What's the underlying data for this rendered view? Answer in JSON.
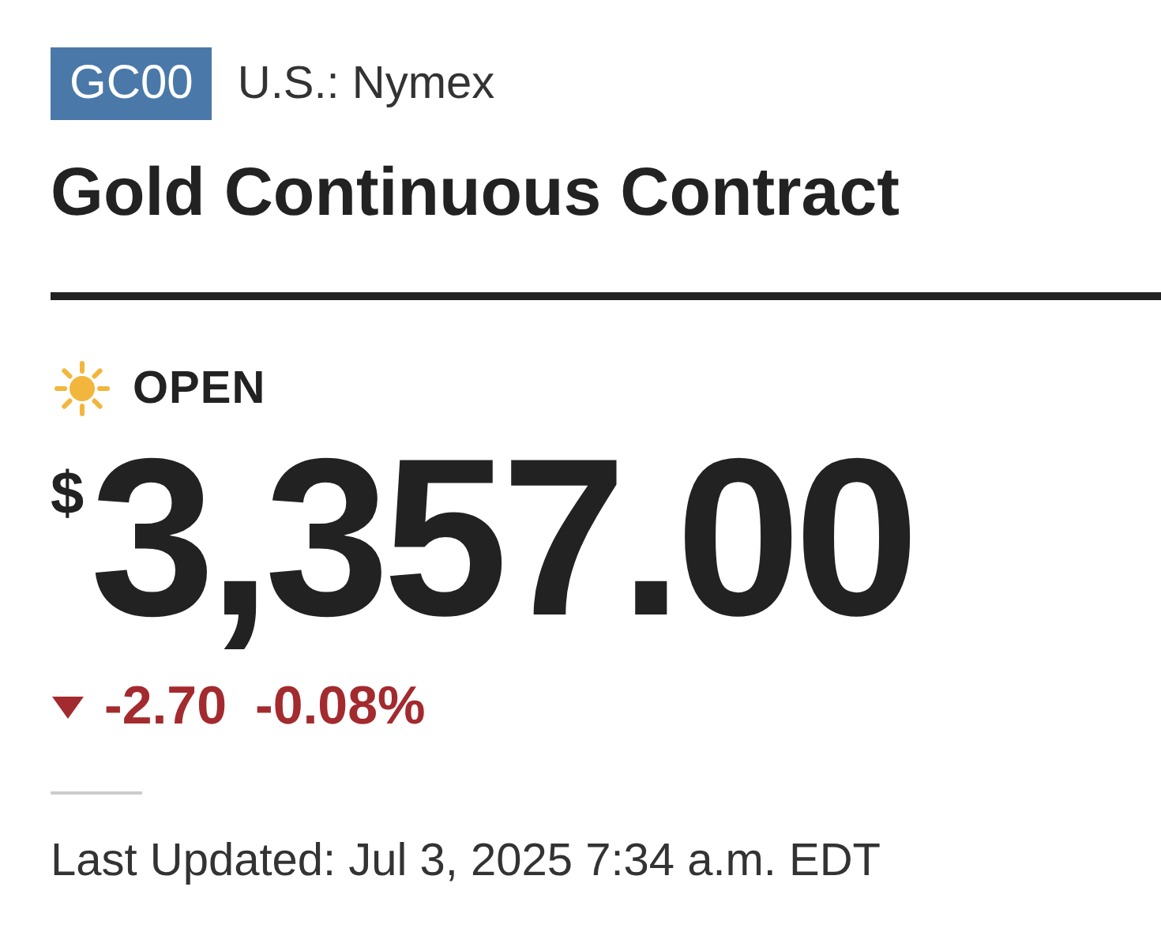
{
  "header": {
    "symbol": "GC00",
    "exchange": "U.S.: Nymex",
    "title": "Gold Continuous Contract"
  },
  "status": {
    "kind": "open",
    "label": "OPEN"
  },
  "quote": {
    "currency": "$",
    "price": "3,357.00",
    "falling": true,
    "change": "-2.70",
    "change_percent": "-0.08%"
  },
  "updated": "Last Updated: Jul 3, 2025 7:34 a.m. EDT"
}
